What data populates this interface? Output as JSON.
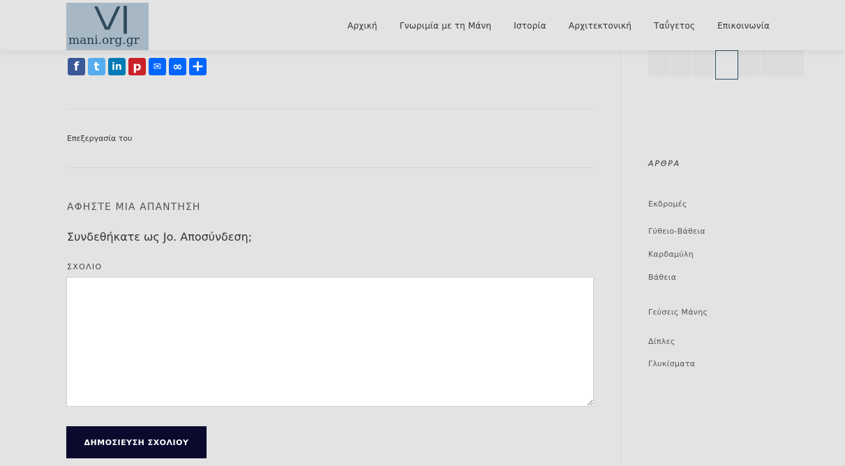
{
  "header": {
    "logo_text": "mani.org.gr",
    "nav": [
      "Αρχική",
      "Γνωριμία με τη Μάνη",
      "Ιστορία",
      "Αρχιτεκτονική",
      "Ταΰγετος",
      "Επικοινωνία"
    ]
  },
  "share": [
    {
      "name": "facebook",
      "glyph": "f",
      "color": "#3b5998"
    },
    {
      "name": "twitter",
      "glyph": "t",
      "color": "#55acee"
    },
    {
      "name": "linkedin",
      "glyph": "in",
      "color": "#007bb5"
    },
    {
      "name": "pinterest",
      "glyph": "p",
      "color": "#cb2027"
    },
    {
      "name": "email",
      "glyph": "✉",
      "color": "#0166ff"
    },
    {
      "name": "copy-link",
      "glyph": "∞",
      "color": "#0166ff"
    },
    {
      "name": "more",
      "glyph": "+",
      "color": "#0166ff"
    }
  ],
  "post": {
    "edited_label": "Επεξεργασία του"
  },
  "reply": {
    "title": "ΑΦΗΣΤΕ ΜΙΑ ΑΠΑΝΤΗΣΗ",
    "logged_in_prefix": "Συνδεθήκατε ως ",
    "user": "Jo",
    "separator": ". ",
    "logout": "Αποσύνδεση;",
    "comment_label": "ΣΧΟΛΙΟ",
    "comment_value": "",
    "submit_label": "ΔΗΜΟΣΙΕΥΣΗ ΣΧΟΛΙΟΥ"
  },
  "sidebar": {
    "heading": "ΑΡΘΡΑ",
    "items": [
      "Εκδρομές",
      "Γύθειο-Βάθεια",
      "Καρδαμύλη",
      "Βάθεια",
      "Γεύσεις Μάνης",
      "Δίπλες",
      "Γλυκίσματα"
    ]
  }
}
